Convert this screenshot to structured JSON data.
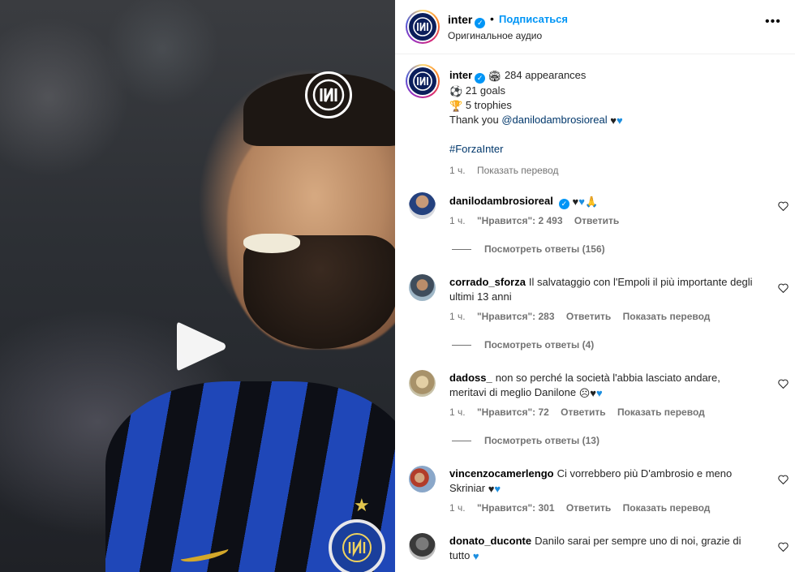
{
  "video": {
    "logo": "inter-logo",
    "play_icon": "play-icon"
  },
  "header": {
    "username": "inter",
    "separator": "•",
    "follow_label": "Подписаться",
    "audio_label": "Оригинальное аудио",
    "more_icon": "more-icon"
  },
  "caption": {
    "username": "inter",
    "line1": "284 appearances",
    "line2": "21 goals",
    "line3": "5 trophies",
    "thanks": "Thank you",
    "mention": "@danilodambrosioreal",
    "hashtag": "#ForzaInter",
    "time": "1 ч.",
    "translate": "Показать перевод"
  },
  "comments": [
    {
      "username": "danilodambrosioreal",
      "text": "",
      "time": "1 ч.",
      "likes": "\"Нравится\": 2 493",
      "reply": "Ответить",
      "translate": "",
      "replies": "Посмотреть ответы (156)"
    },
    {
      "username": "corrado_sforza",
      "text": "Il salvataggio con l'Empoli il più importante degli ultimi 13 anni",
      "time": "1 ч.",
      "likes": "\"Нравится\": 283",
      "reply": "Ответить",
      "translate": "Показать перевод",
      "replies": "Посмотреть ответы (4)"
    },
    {
      "username": "dadoss_",
      "text": "non so perché la società l'abbia lasciato andare, meritavi di meglio Danilone",
      "time": "1 ч.",
      "likes": "\"Нравится\": 72",
      "reply": "Ответить",
      "translate": "Показать перевод",
      "replies": "Посмотреть ответы (13)"
    },
    {
      "username": "vincenzocamerlengo",
      "text": "Ci vorrebbero più D'ambrosio e meno Skriniar",
      "time": "1 ч.",
      "likes": "\"Нравится\": 301",
      "reply": "Ответить",
      "translate": "Показать перевод",
      "replies": ""
    },
    {
      "username": "donato_duconte",
      "text": "Danilo sarai per sempre uno di noi, grazie di tutto",
      "time": "",
      "likes": "",
      "reply": "",
      "translate": "",
      "replies": ""
    }
  ],
  "colors": {
    "accent": "#0095f6",
    "link": "#00376b",
    "muted": "#737373",
    "inter_blue": "#0b1e5b"
  }
}
